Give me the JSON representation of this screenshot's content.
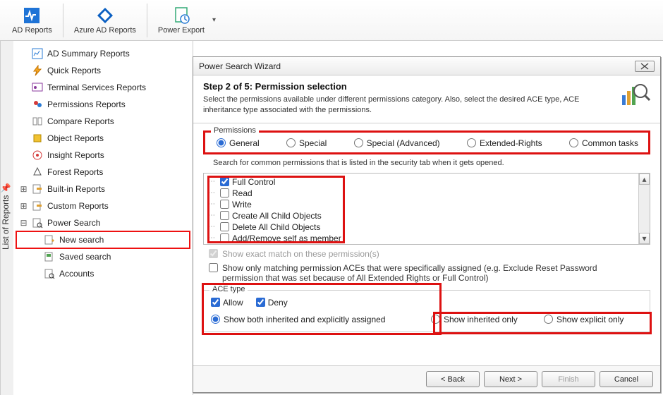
{
  "ribbon": {
    "ad_reports": "AD Reports",
    "azure_ad_reports": "Azure AD Reports",
    "power_export": "Power Export"
  },
  "sidebar_tab": "List of Reports",
  "tree": {
    "items": [
      {
        "label": "AD Summary Reports",
        "icon": "summary"
      },
      {
        "label": "Quick Reports",
        "icon": "quick"
      },
      {
        "label": "Terminal Services Reports",
        "icon": "terminal"
      },
      {
        "label": "Permissions Reports",
        "icon": "perm"
      },
      {
        "label": "Compare Reports",
        "icon": "compare"
      },
      {
        "label": "Object Reports",
        "icon": "object"
      },
      {
        "label": "Insight Reports",
        "icon": "insight"
      },
      {
        "label": "Forest Reports",
        "icon": "forest"
      }
    ],
    "builtin": "Built-in Reports",
    "custom": "Custom Reports",
    "power_search": "Power Search",
    "new_search": "New search",
    "saved_search": "Saved search",
    "accounts": "Accounts"
  },
  "wizard": {
    "title": "Power Search Wizard",
    "step_title": "Step 2 of 5:  Permission selection",
    "step_desc": "Select the permissions available under different permissions category. Also, select the desired ACE type, ACE inheritance type associated with the permissions.",
    "perm_group": "Permissions",
    "radios": {
      "general": "General",
      "special": "Special",
      "special_adv": "Special (Advanced)",
      "extended": "Extended-Rights",
      "common": "Common tasks"
    },
    "perm_desc": "Search for common permissions that is listed in the security tab when it gets opened.",
    "perm_tree": [
      {
        "label": "Full Control",
        "checked": true
      },
      {
        "label": "Read",
        "checked": false
      },
      {
        "label": "Write",
        "checked": false
      },
      {
        "label": "Create All Child Objects",
        "checked": false
      },
      {
        "label": "Delete All Child Objects",
        "checked": false
      },
      {
        "label": "Add/Remove self as member",
        "checked": false
      }
    ],
    "show_exact": "Show exact match on these permission(s)",
    "show_matching": "Show only matching permission ACEs that were specifically assigned (e.g. Exclude Reset Password permission that was set because of All Extended Rights or Full Control)",
    "ace_group": "ACE type",
    "allow": "Allow",
    "deny": "Deny",
    "show_both": "Show both inherited and explicitly assigned",
    "show_inherited": "Show inherited only",
    "show_explicit": "Show explicit only",
    "buttons": {
      "back": "<  Back",
      "next": "Next  >",
      "finish": "Finish",
      "cancel": "Cancel"
    }
  }
}
